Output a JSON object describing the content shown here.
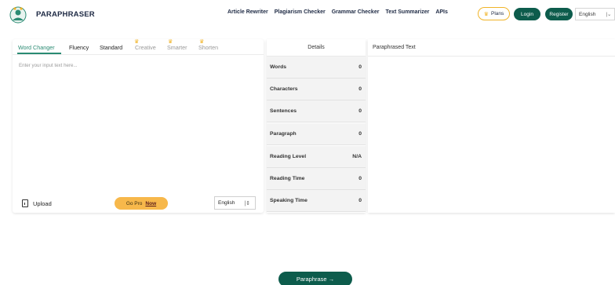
{
  "header": {
    "brand": "PARAPHRASER",
    "nav": [
      "Article Rewriter",
      "Plagiarism Checker",
      "Grammar Checker",
      "Text Summarizer",
      "APIs"
    ],
    "plans_label": "Plans",
    "login_label": "Login",
    "register_label": "Register",
    "language": "English"
  },
  "input": {
    "tabs": [
      {
        "label": "Word Changer",
        "locked": false
      },
      {
        "label": "Fluency",
        "locked": false
      },
      {
        "label": "Standard",
        "locked": false
      },
      {
        "label": "Creative",
        "locked": true
      },
      {
        "label": "Smarter",
        "locked": true
      },
      {
        "label": "Shorten",
        "locked": true
      }
    ],
    "placeholder": "Enter your input text here...",
    "upload_label": "Upload",
    "gopro_label": "Go Pro",
    "gopro_now": "Now",
    "language": "English"
  },
  "details": {
    "title": "Details",
    "rows": [
      {
        "label": "Words",
        "value": "0"
      },
      {
        "label": "Characters",
        "value": "0"
      },
      {
        "label": "Sentences",
        "value": "0"
      },
      {
        "label": "Paragraph",
        "value": "0"
      },
      {
        "label": "Reading Level",
        "value": "N/A"
      },
      {
        "label": "Reading Time",
        "value": "0"
      },
      {
        "label": "Speaking Time",
        "value": "0"
      }
    ]
  },
  "output": {
    "title": "Paraphrased Text"
  },
  "actions": {
    "paraphrase_label": "Paraphrase →"
  },
  "colors": {
    "brand_green": "#0d5c4c",
    "accent_teal": "#2a8b73",
    "gold": "#f0b429"
  }
}
